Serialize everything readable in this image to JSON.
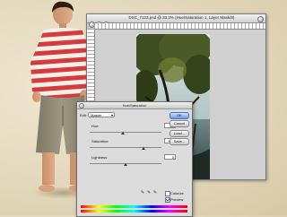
{
  "document_window": {
    "title": "DSC_7123.psd @ 33.3% (Hue/Saturation 1, Layer Mask/8)"
  },
  "hue_saturation_dialog": {
    "title": "Hue/Saturation",
    "edit_label": "Edit:",
    "edit_value": "Master",
    "hue_label": "Hue:",
    "hue_value": "-15",
    "hue_position": 0.46,
    "saturation_label": "Saturation:",
    "saturation_value": "+50",
    "saturation_position": 0.75,
    "lightness_label": "Lightness:",
    "lightness_value": "0",
    "lightness_position": 0.5,
    "ok_label": "OK",
    "cancel_label": "Cancel",
    "load_label": "Load...",
    "save_label": "Save...",
    "colorize_label": "Colorize",
    "preview_label": "Preview",
    "colorize_checked": false,
    "preview_checked": true
  },
  "colors": {
    "accent": "#6a9ae0",
    "shirt_red": "#d23b3b",
    "shorts": "#8a8672"
  }
}
